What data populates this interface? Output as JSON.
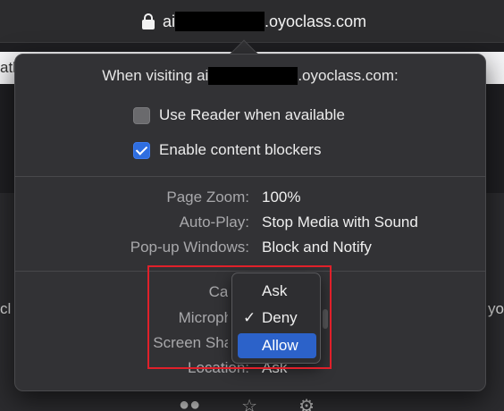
{
  "browser": {
    "url_prefix": "ai",
    "url_suffix": ".oyoclass.com"
  },
  "page": {
    "strip_text": "ath",
    "left_text": "cl",
    "right_text": "t yo"
  },
  "popover": {
    "title_prefix": "When visiting ai",
    "title_suffix": ".oyoclass.com:",
    "checkboxes": [
      {
        "label": "Use Reader when available",
        "checked": false
      },
      {
        "label": "Enable content blockers",
        "checked": true
      }
    ],
    "settings": [
      {
        "label": "Page Zoom:",
        "value": "100%"
      },
      {
        "label": "Auto-Play:",
        "value": "Stop Media with Sound"
      },
      {
        "label": "Pop-up Windows:",
        "value": "Block and Notify"
      }
    ],
    "permissions": {
      "camera_label": "Came",
      "microphone_label": "Microphon",
      "screen_sharing_label": "Screen Sharin",
      "location_label": "Location:",
      "location_value": "Ask"
    }
  },
  "dropdown": {
    "items": [
      {
        "label": "Ask",
        "checked": false,
        "selected": false
      },
      {
        "label": "Deny",
        "checked": true,
        "selected": false
      },
      {
        "label": "Allow",
        "checked": false,
        "selected": true
      }
    ],
    "check_glyph": "✓"
  },
  "icons": {
    "lock": "lock-icon",
    "people": "people-icon",
    "star": "star-icon",
    "gear": "gear-icon"
  },
  "colors": {
    "accent": "#2c62c9",
    "highlight_box": "#e0202a"
  }
}
